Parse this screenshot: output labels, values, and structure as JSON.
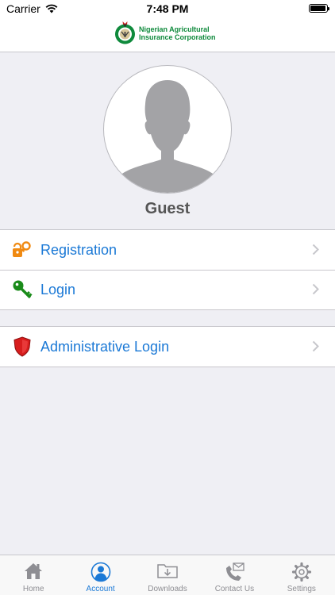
{
  "status_bar": {
    "carrier": "Carrier",
    "time": "7:48 PM",
    "battery_level": 0.95
  },
  "header": {
    "logo_line1": "Nigerian Agricultural",
    "logo_line2": "Insurance Corporation"
  },
  "profile": {
    "name": "Guest"
  },
  "menu": {
    "registration": {
      "label": "Registration",
      "icon": "key-lock-icon"
    },
    "login": {
      "label": "Login",
      "icon": "key-icon"
    },
    "admin_login": {
      "label": "Administrative Login",
      "icon": "shield-icon"
    }
  },
  "tab_bar": {
    "home": "Home",
    "account": "Account",
    "downloads": "Downloads",
    "contact": "Contact Us",
    "settings": "Settings",
    "active": "account"
  },
  "colors": {
    "accent": "#1b79d6",
    "brand_green": "#0f8a3c",
    "admin_red": "#d71d1d",
    "login_green": "#1a8b1a",
    "registration_orange": "#f08a12"
  }
}
